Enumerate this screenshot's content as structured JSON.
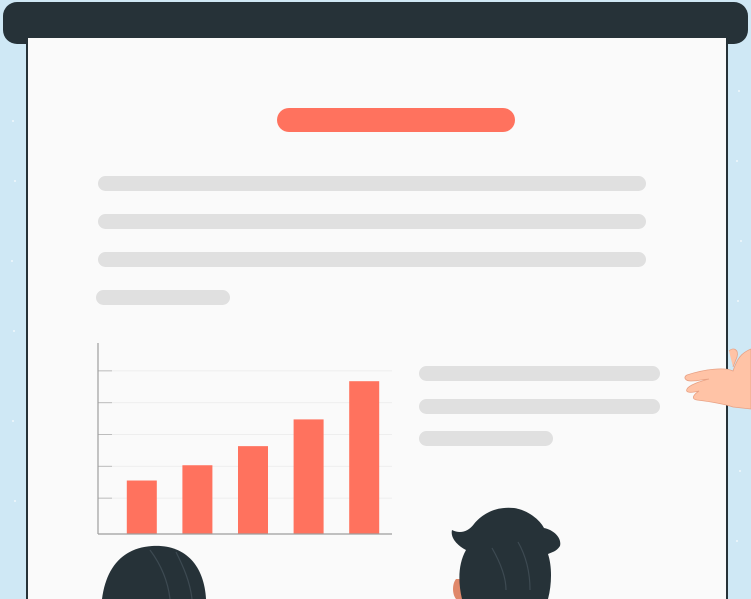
{
  "colors": {
    "accent": "#ff725e",
    "frame": "#263238",
    "placeholder": "#e0e0e0",
    "screen": "#fafafa",
    "background": "#cfe8f5",
    "skin": "#ffc3a6"
  },
  "chart_data": {
    "type": "bar",
    "categories": [
      "",
      "",
      "",
      "",
      ""
    ],
    "values": [
      1.4,
      1.8,
      2.3,
      3.0,
      4.0
    ],
    "ylim": [
      0,
      5
    ],
    "grid": true,
    "title": "",
    "xlabel": "",
    "ylabel": ""
  }
}
